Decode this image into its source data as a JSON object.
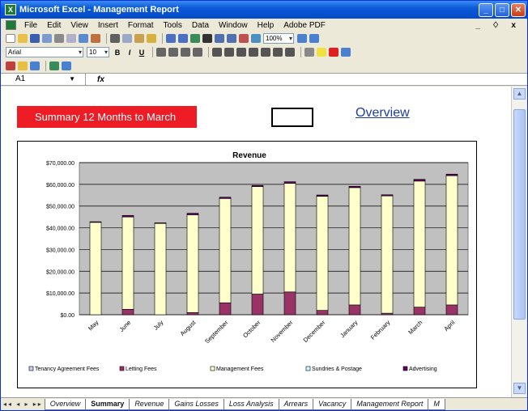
{
  "window": {
    "title": "Microsoft Excel - Management Report",
    "app_icon": "excel-icon"
  },
  "menubar": {
    "items": [
      "File",
      "Edit",
      "View",
      "Insert",
      "Format",
      "Tools",
      "Data",
      "Window",
      "Help",
      "Adobe PDF"
    ],
    "doc_controls": "_ ♢ x"
  },
  "toolbar": {
    "zoom": "100%",
    "font": "Arial",
    "font_size": "10",
    "bold": "B",
    "italic": "I",
    "underline": "U"
  },
  "formula_bar": {
    "cell_ref": "A1",
    "fx": "fx",
    "content": ""
  },
  "sheet": {
    "banner": "Summary 12 Months to March",
    "overview_link": "Overview",
    "colors": {
      "banner": "#ee1c25",
      "link": "#1f3d99"
    }
  },
  "chart_data": {
    "type": "bar",
    "stacked": true,
    "title": "Revenue",
    "xlabel": "",
    "ylabel": "",
    "ylim": [
      0,
      70000
    ],
    "yticks": [
      "$70,000.00",
      "$60,000.00",
      "$50,000.00",
      "$40,000.00",
      "$30,000.00",
      "$20,000.00",
      "$10,000.00",
      "$0.00"
    ],
    "ytick_values": [
      70000,
      60000,
      50000,
      40000,
      30000,
      20000,
      10000,
      0
    ],
    "grid": true,
    "legend_position": "bottom",
    "categories": [
      "May",
      "June",
      "July",
      "August",
      "September",
      "October",
      "November",
      "December",
      "January",
      "February",
      "March",
      "April"
    ],
    "series": [
      {
        "name": "Tenancy Agreement Fees",
        "color": "#ccccff",
        "values": [
          0,
          0,
          0,
          0,
          0,
          0,
          0,
          0,
          0,
          0,
          0,
          0
        ]
      },
      {
        "name": "Letting Fees",
        "color": "#993366",
        "values": [
          0,
          2500,
          0,
          1000,
          5500,
          9500,
          10500,
          2000,
          4500,
          700,
          3500,
          4500
        ]
      },
      {
        "name": "Management Fees",
        "color": "#ffffcc",
        "values": [
          42500,
          42500,
          42000,
          45000,
          48000,
          49500,
          50000,
          52500,
          54000,
          54000,
          58000,
          59500
        ]
      },
      {
        "name": "Sundries & Postage",
        "color": "#ccffff",
        "values": [
          0,
          0,
          0,
          0,
          0,
          0,
          0,
          0,
          0,
          0,
          0,
          0
        ]
      },
      {
        "name": "Advertising",
        "color": "#660066",
        "values": [
          300,
          700,
          300,
          700,
          600,
          500,
          700,
          600,
          600,
          500,
          800,
          700
        ]
      }
    ]
  },
  "tabs": {
    "nav": "◂◂ ◂ ▸ ▸▸",
    "items": [
      "Overview",
      "Summary",
      "Revenue",
      "Gains Losses",
      "Loss Analysis",
      "Arrears",
      "Vacancy",
      "Management Report",
      "M"
    ],
    "active": "Summary"
  }
}
